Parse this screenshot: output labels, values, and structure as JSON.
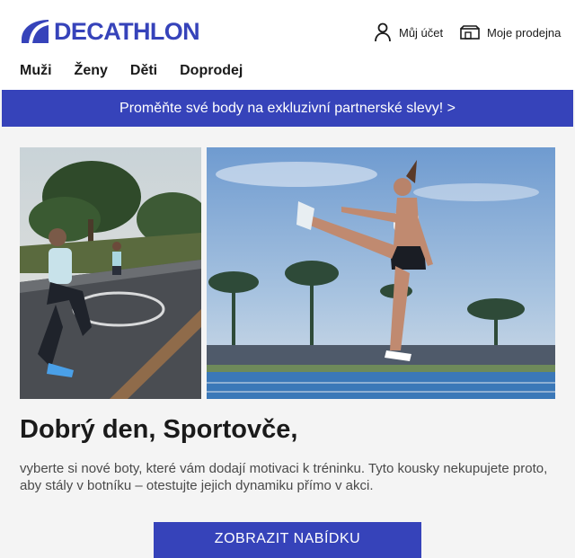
{
  "header": {
    "logo_text": "DECATHLON",
    "account_label": "Můj účet",
    "account_icon": "user-icon",
    "stores_label": "Moje prodejna",
    "stores_icon": "store-icon"
  },
  "nav": [
    {
      "label": "Muži"
    },
    {
      "label": "Ženy"
    },
    {
      "label": "Děti"
    },
    {
      "label": "Doprodej"
    }
  ],
  "promo": {
    "text": "Proměňte své body na exkluzivní partnerské slevy! >"
  },
  "hero": {
    "left_image": "runners-on-road",
    "right_image": "athlete-leg-swing-palm-trees"
  },
  "content": {
    "greeting": "Dobrý den, Sportovče,",
    "body": "vyberte si nové boty, které vám dodají motivaci k tréninku. Tyto kousky nekupujete proto, aby stály v botníku – otestujte jejich dynamiku přímo v akci.",
    "cta_label": "ZOBRAZIT NABÍDKU"
  },
  "colors": {
    "brand": "#3643ba",
    "background": "#f4f4f4",
    "text": "#1a1a1a"
  }
}
